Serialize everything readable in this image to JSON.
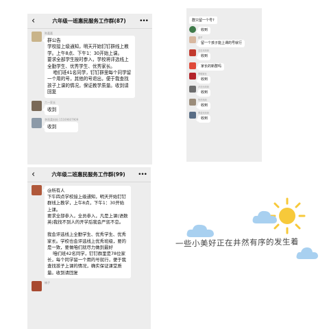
{
  "panel1": {
    "title": "六年级一班惠民服务工作群(87)",
    "back_icon": "chevron-left-icon",
    "more_icon": "more-icon",
    "messages": [
      {
        "sender": "陈嘉嘉",
        "text": "群公告\n学校接上级通知，明天开始钉钉群线上教学。上午8点、下午1：30开始上课。\n要求全部学生按时参入，学校将评选线上全勤学生、优秀学生、优秀家长。\n    咱们班41名同学，钉钉群里每个同学留一个用的号，其他的号退出，便于我查找孩子上课的情况，保证教学质量。收到请回复"
      },
      {
        "sender": "六一家长",
        "text": "收到"
      },
      {
        "sender": "李雨柔妈妈 15169607909",
        "text": "收到"
      }
    ]
  },
  "panel2": {
    "top_text": "群只留一个号?",
    "messages": [
      {
        "sender": "",
        "text": "收到"
      },
      {
        "sender": "孩子",
        "text": "留一个孩子能上课的号就行"
      },
      {
        "sender": "王石天妈妈",
        "text": "收到"
      },
      {
        "sender": "",
        "text": "家长的新群吗"
      },
      {
        "sender": "李明家长",
        "text": "收到"
      },
      {
        "sender": "卢沂乐妈妈",
        "text": "收到"
      },
      {
        "sender": "鲁东妈妈",
        "text": "收到"
      },
      {
        "sender": "李浩天妈妈",
        "text": "收到"
      }
    ]
  },
  "panel3": {
    "title": "六年级二班惠民服务工作群(99)",
    "back_icon": "chevron-left-icon",
    "more_icon": "more-icon",
    "messages": [
      {
        "sender": "",
        "text": "@所有人\n下午四点学校接上级通知，明天开始钉钉群线上教学，上午8点，下午1：30开始上课。\n要求全部参入，全员参入，凡是上课(语数英)我找不到人的开学后我会严惩不怠。\n\n我会评选线上全勤学生、优秀学生、优秀家长。学校也会评选线上优秀班级，要的是一致，要做咱们就尽力做到最好\n    咱们班42名同学，钉钉群里是78位家长，每个同学留一个用的号就行，便于我查找孩子上课的情况，确实保证课堂质量。收到请回复"
      },
      {
        "sender": "楠子",
        "text": ""
      }
    ]
  },
  "decor": {
    "caption": "一些小美好正在井然有序的发生着",
    "sun_icon": "sun-icon",
    "cloud_icon": "cloud-icon",
    "sun_color": "#f7c93a",
    "cloud_color": "#a8d0f0"
  }
}
